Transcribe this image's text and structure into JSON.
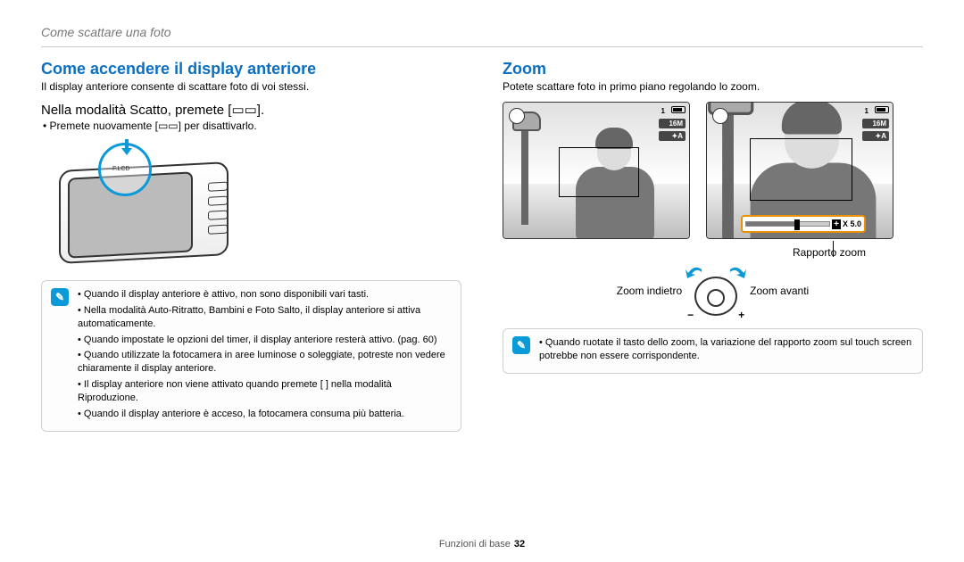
{
  "header": {
    "breadcrumb": "Come scattare una foto"
  },
  "left": {
    "heading": "Come accendere il display anteriore",
    "intro": "Il display anteriore consente di scattare foto di voi stessi.",
    "step": "Nella modalità Scatto, premete [",
    "step_end": "].",
    "sub_bullet": "Premete nuovamente [",
    "sub_bullet_end": "] per disattivarlo.",
    "flcd": "F.LCD",
    "notes": [
      "Quando il display anteriore è attivo, non sono disponibili vari tasti.",
      "Nella modalità Auto-Ritratto, Bambini e Foto Salto, il display anteriore si attiva automaticamente.",
      "Quando impostate le opzioni del timer, il display anteriore resterà attivo. (pag. 60)",
      "Quando utilizzate la fotocamera in aree luminose o soleggiate, potreste non vedere chiaramente il display anteriore.",
      "Il display anteriore non viene attivato quando premete [        ] nella modalità Riproduzione.",
      "Quando il display anteriore è acceso, la fotocamera consuma più batteria."
    ]
  },
  "right": {
    "heading": "Zoom",
    "intro": "Potete scattare foto in primo piano regolando lo zoom.",
    "overlay": {
      "count": "1",
      "res": "16M",
      "flash": "✦A",
      "zoom_readout": "X 5.0"
    },
    "zoom_ratio_label": "Rapporto zoom",
    "zoom_out_label": "Zoom indietro",
    "zoom_in_label": "Zoom avanti",
    "note": "Quando ruotate il tasto dello zoom, la variazione del rapporto zoom sul touch screen potrebbe non essere corrispondente."
  },
  "footer": {
    "section": "Funzioni di base",
    "page": "32"
  },
  "icon_glyph": "▭▭"
}
